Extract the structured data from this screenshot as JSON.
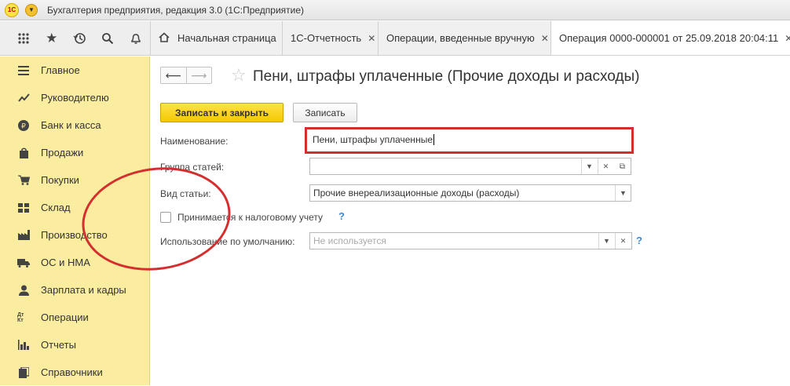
{
  "window": {
    "logo_text": "1С",
    "title": "Бухгалтерия предприятия, редакция 3.0  (1С:Предприятие)"
  },
  "toolbar": {
    "tabs": [
      {
        "label": "Начальная страница"
      },
      {
        "label": "1С-Отчетность"
      },
      {
        "label": "Операции, введенные вручную"
      },
      {
        "label": "Операция 0000-000001 от 25.09.2018 20:04:11"
      }
    ]
  },
  "sidebar": {
    "items": [
      {
        "label": "Главное",
        "icon": "menu-icon"
      },
      {
        "label": "Руководителю",
        "icon": "chart-icon"
      },
      {
        "label": "Банк и касса",
        "icon": "ruble-icon"
      },
      {
        "label": "Продажи",
        "icon": "bag-icon"
      },
      {
        "label": "Покупки",
        "icon": "cart-icon"
      },
      {
        "label": "Склад",
        "icon": "warehouse-icon"
      },
      {
        "label": "Производство",
        "icon": "factory-icon"
      },
      {
        "label": "ОС и НМА",
        "icon": "truck-icon"
      },
      {
        "label": "Зарплата и кадры",
        "icon": "person-icon"
      },
      {
        "label": "Операции",
        "icon": "dt-kt-icon"
      },
      {
        "label": "Отчеты",
        "icon": "bar-chart-icon"
      },
      {
        "label": "Справочники",
        "icon": "book-icon"
      }
    ],
    "dt_kt_text": "Дт Кт"
  },
  "form": {
    "title": "Пени, штрафы уплаченные (Прочие доходы и расходы)",
    "save_close_label": "Записать и закрыть",
    "save_label": "Записать",
    "name_label": "Наименование:",
    "name_value": "Пени, штрафы уплаченные",
    "group_label": "Группа статей:",
    "group_value": "",
    "type_label": "Вид статьи:",
    "type_value": "Прочие внереализационные доходы (расходы)",
    "tax_label": "Принимается к налоговому учету",
    "tax_checked": false,
    "default_use_label": "Использование по умолчанию:",
    "default_use_placeholder": "Не используется",
    "help_text": "?"
  },
  "colors": {
    "sidebar_bg": "#fbeda0",
    "primary_button": "#f5c800",
    "annotation_red": "#d32f2f",
    "help_blue": "#3b8ad8"
  }
}
